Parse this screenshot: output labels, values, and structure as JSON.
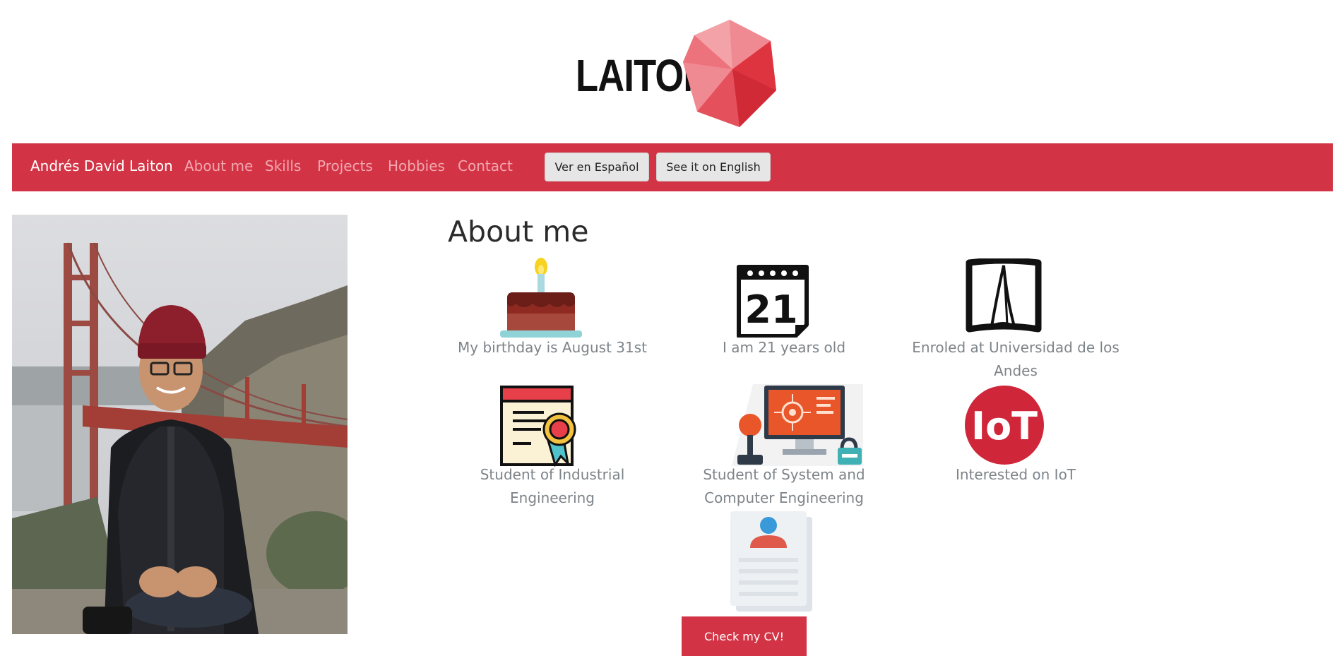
{
  "logo": {
    "text": "LAITON"
  },
  "navbar": {
    "brand": "Andrés David Laiton",
    "links": [
      "About me",
      "Skills",
      "Projects",
      "Hobbies",
      "Contact"
    ],
    "buttons": [
      "Ver en Español",
      "See it on English"
    ]
  },
  "about": {
    "title": "About me",
    "facts": [
      {
        "icon": "birthday-cake-icon",
        "text": "My birthday is August 31st"
      },
      {
        "icon": "calendar-icon",
        "icon_text": "21",
        "text": "I am 21 years old"
      },
      {
        "icon": "university-logo-icon",
        "text": "Enroled at Universidad de los Andes"
      },
      {
        "icon": "certificate-icon",
        "text": "Student of Industrial Engineering"
      },
      {
        "icon": "computer-system-icon",
        "text": "Student of System and Computer Engineering"
      },
      {
        "icon": "iot-icon",
        "icon_text": "IoT",
        "text": "Interested on IoT"
      }
    ],
    "cv_button": "Check my CV!"
  },
  "colors": {
    "brand_red": "#d33445",
    "nav_link": "#f2a7b0",
    "caption": "#7d8489"
  }
}
